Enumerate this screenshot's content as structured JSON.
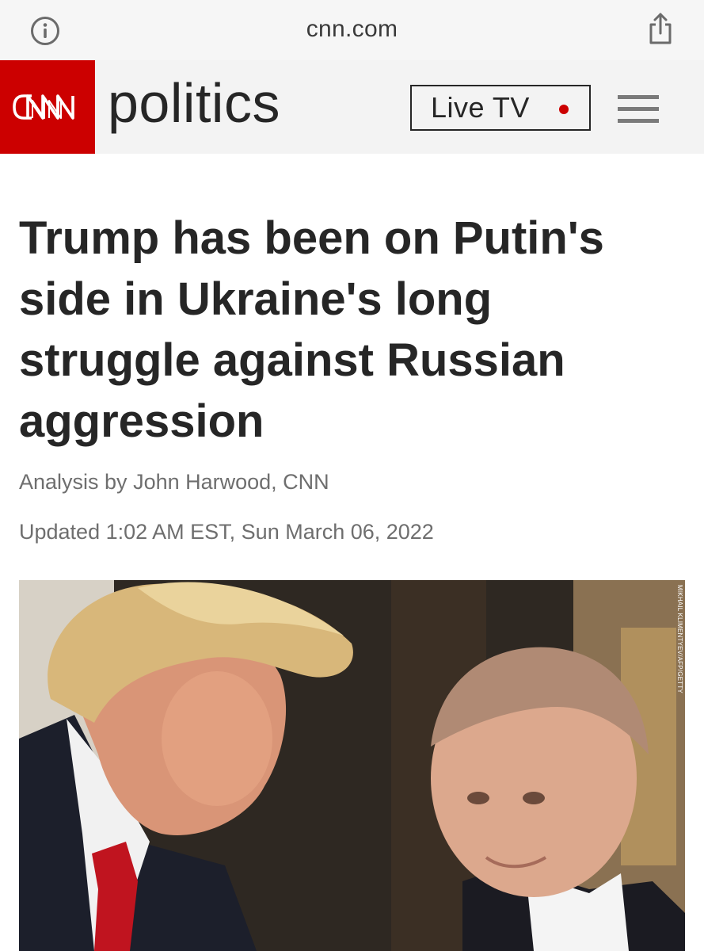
{
  "browser": {
    "url": "cnn.com",
    "info_icon": "info-circle-icon",
    "share_icon": "share-icon"
  },
  "header": {
    "logo_text": "CNN",
    "section": "politics",
    "live_tv_label": "Live TV",
    "menu_icon": "hamburger-menu-icon",
    "colors": {
      "brand_red": "#cc0000",
      "header_bg": "#f3f3f3"
    }
  },
  "article": {
    "headline": "Trump has been on Putin's side in Ukraine's long struggle against Russian aggression",
    "byline_prefix": "Analysis by ",
    "author": "John Harwood, CNN",
    "updated": "Updated 1:02 AM EST, Sun March 06, 2022"
  },
  "photo": {
    "credit": "MIKHAIL KLIMENTYEV/AFP/GETTY"
  }
}
